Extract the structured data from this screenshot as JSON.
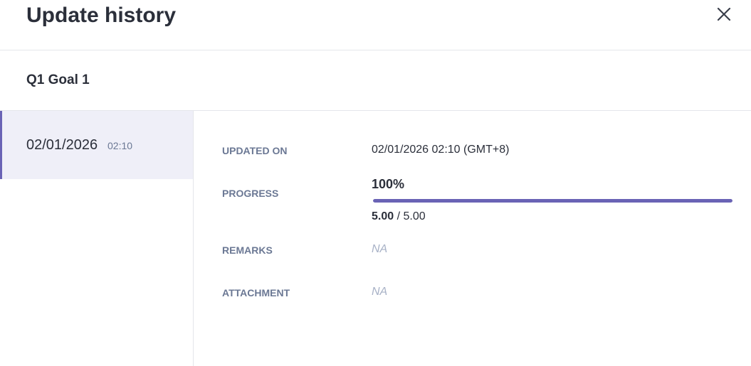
{
  "header": {
    "title": "Update history"
  },
  "goal": {
    "name": "Q1 Goal 1"
  },
  "history": [
    {
      "date": "02/01/2026",
      "time": "02:10",
      "selected": true
    }
  ],
  "details": {
    "updated_on": {
      "label": "UPDATED ON",
      "value": "02/01/2026 02:10 (GMT+8)"
    },
    "progress": {
      "label": "PROGRESS",
      "percent_text": "100%",
      "percent": 100,
      "current": "5.00",
      "separator": " / ",
      "target": "5.00"
    },
    "remarks": {
      "label": "REMARKS",
      "value": "NA"
    },
    "attachment": {
      "label": "ATTACHMENT",
      "value": "NA"
    }
  },
  "colors": {
    "accent": "#6a63b5",
    "selected_bg": "#efeff8",
    "label": "#6b7894",
    "placeholder": "#a7b1c6"
  },
  "icons": {
    "close": "close-icon"
  }
}
